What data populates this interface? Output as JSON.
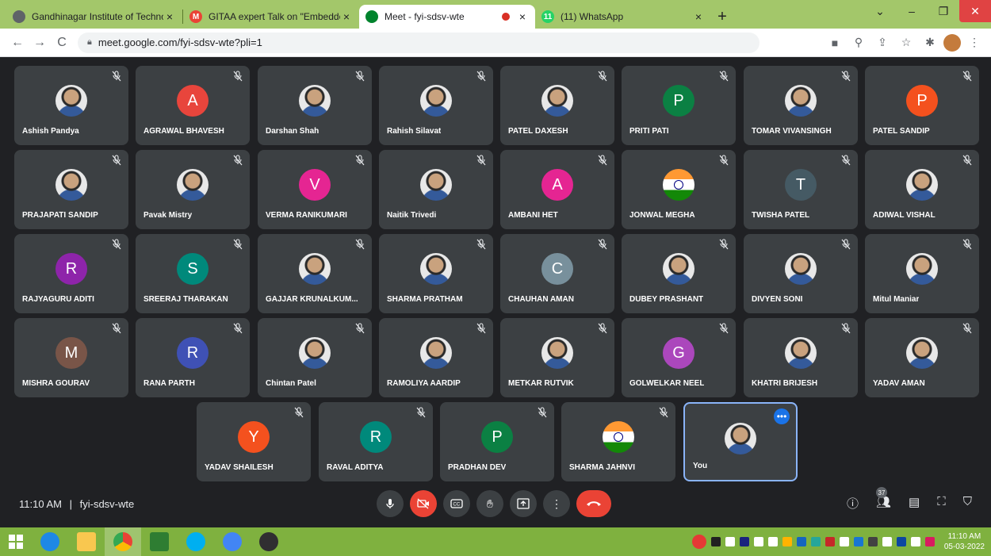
{
  "browser": {
    "tabs": [
      {
        "title": "Gandhinagar Institute of Technol",
        "favicon_color": "#5f6368"
      },
      {
        "title": "GITAA expert Talk on \"Embedded",
        "favicon_color": "#ea4335",
        "favicon_letter": "M"
      },
      {
        "title": "Meet - fyi-sdsv-wte",
        "favicon_color": "#00832d",
        "recording": true,
        "active": true
      },
      {
        "title": "(11) WhatsApp",
        "favicon_color": "#25d366",
        "favicon_letter": "11"
      }
    ],
    "url": "meet.google.com/fyi-sdsv-wte?pli=1"
  },
  "participants": [
    {
      "name": "Ashish Pandya",
      "kind": "photo"
    },
    {
      "name": "AGRAWAL BHAVESH",
      "kind": "letter",
      "letter": "A",
      "color": "#e8453c"
    },
    {
      "name": "Darshan Shah",
      "kind": "photo"
    },
    {
      "name": "Rahish Silavat",
      "kind": "photo"
    },
    {
      "name": "PATEL DAXESH",
      "kind": "photo"
    },
    {
      "name": "PRITI PATI",
      "kind": "letter",
      "letter": "P",
      "color": "#0b8043"
    },
    {
      "name": "TOMAR VIVANSINGH",
      "kind": "photo"
    },
    {
      "name": "PATEL SANDIP",
      "kind": "letter",
      "letter": "P",
      "color": "#f4511e"
    },
    {
      "name": "PRAJAPATI SANDIP",
      "kind": "photo"
    },
    {
      "name": "Pavak Mistry",
      "kind": "photo"
    },
    {
      "name": "VERMA RANIKUMARI",
      "kind": "letter",
      "letter": "V",
      "color": "#e52592"
    },
    {
      "name": "Naitik Trivedi",
      "kind": "photo"
    },
    {
      "name": "AMBANI HET",
      "kind": "letter",
      "letter": "A",
      "color": "#e52592"
    },
    {
      "name": "JONWAL MEGHA",
      "kind": "flag"
    },
    {
      "name": "TWISHA PATEL",
      "kind": "letter",
      "letter": "T",
      "color": "#455a64"
    },
    {
      "name": "ADIWAL VISHAL",
      "kind": "photo"
    },
    {
      "name": "RAJYAGURU ADITI",
      "kind": "letter",
      "letter": "R",
      "color": "#8e24aa"
    },
    {
      "name": "SREERAJ THARAKAN",
      "kind": "letter",
      "letter": "S",
      "color": "#00897b"
    },
    {
      "name": "GAJJAR KRUNALKUM...",
      "kind": "photo"
    },
    {
      "name": "SHARMA PRATHAM",
      "kind": "photo"
    },
    {
      "name": "CHAUHAN AMAN",
      "kind": "letter",
      "letter": "C",
      "color": "#78909c"
    },
    {
      "name": "DUBEY PRASHANT",
      "kind": "photo"
    },
    {
      "name": "DIVYEN SONI",
      "kind": "photo"
    },
    {
      "name": "Mitul Maniar",
      "kind": "photo"
    },
    {
      "name": "MISHRA GOURAV",
      "kind": "letter",
      "letter": "M",
      "color": "#795548"
    },
    {
      "name": "RANA PARTH",
      "kind": "letter",
      "letter": "R",
      "color": "#3f51b5"
    },
    {
      "name": "Chintan Patel",
      "kind": "photo"
    },
    {
      "name": "RAMOLIYA AARDIP",
      "kind": "photo"
    },
    {
      "name": "METKAR RUTVIK",
      "kind": "photo"
    },
    {
      "name": "GOLWELKAR NEEL",
      "kind": "letter",
      "letter": "G",
      "color": "#ab47bc"
    },
    {
      "name": "KHATRI BRIJESH",
      "kind": "photo"
    },
    {
      "name": "YADAV AMAN",
      "kind": "photo"
    },
    {
      "name": "YADAV SHAILESH",
      "kind": "letter",
      "letter": "Y",
      "color": "#f4511e"
    },
    {
      "name": "RAVAL ADITYA",
      "kind": "letter",
      "letter": "R",
      "color": "#00897b"
    },
    {
      "name": "PRADHAN DEV",
      "kind": "letter",
      "letter": "P",
      "color": "#0b8043"
    },
    {
      "name": "SHARMA JAHNVI",
      "kind": "flag"
    },
    {
      "name": "You",
      "kind": "photo",
      "self": true
    }
  ],
  "meeting": {
    "time": "11:10 AM",
    "separator": "|",
    "code": "fyi-sdsv-wte",
    "people_count": "37"
  },
  "taskbar": {
    "time": "11:10 AM",
    "date": "05-03-2022"
  }
}
